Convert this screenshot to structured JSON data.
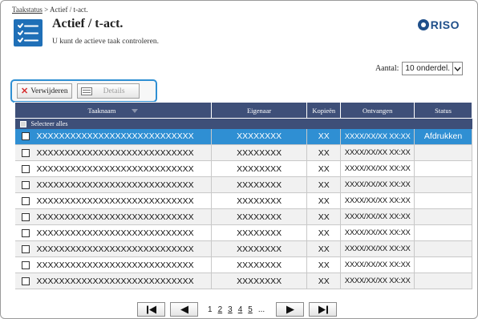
{
  "breadcrumb": {
    "link": "Taakstatus",
    "separator": " > ",
    "current": "Actief / t-act."
  },
  "header": {
    "title": "Actief / t-act.",
    "subtitle": "U kunt de actieve taak controleren.",
    "logo_text": "RISO",
    "icon": "task-list-icon"
  },
  "count": {
    "label": "Aantal:",
    "value": "10 onderdel."
  },
  "toolbar": {
    "delete_label": "Verwijderen",
    "details_label": "Details"
  },
  "table": {
    "columns": [
      "Taaknaam",
      "Eigenaar",
      "Kopieën",
      "Ontvangen",
      "Status"
    ],
    "select_all_label": "Selecteer alles",
    "rows": [
      {
        "name": "XXXXXXXXXXXXXXXXXXXXXXXXXXXX",
        "owner": "XXXXXXXX",
        "copies": "XX",
        "received": "XXXX/XX/XX XX:XX",
        "status": "Afdrukken"
      },
      {
        "name": "XXXXXXXXXXXXXXXXXXXXXXXXXXXX",
        "owner": "XXXXXXXX",
        "copies": "XX",
        "received": "XXXX/XX/XX XX:XX",
        "status": ""
      },
      {
        "name": "XXXXXXXXXXXXXXXXXXXXXXXXXXXX",
        "owner": "XXXXXXXX",
        "copies": "XX",
        "received": "XXXX/XX/XX XX:XX",
        "status": ""
      },
      {
        "name": "XXXXXXXXXXXXXXXXXXXXXXXXXXXX",
        "owner": "XXXXXXXX",
        "copies": "XX",
        "received": "XXXX/XX/XX XX:XX",
        "status": ""
      },
      {
        "name": "XXXXXXXXXXXXXXXXXXXXXXXXXXXX",
        "owner": "XXXXXXXX",
        "copies": "XX",
        "received": "XXXX/XX/XX XX:XX",
        "status": ""
      },
      {
        "name": "XXXXXXXXXXXXXXXXXXXXXXXXXXXX",
        "owner": "XXXXXXXX",
        "copies": "XX",
        "received": "XXXX/XX/XX XX:XX",
        "status": ""
      },
      {
        "name": "XXXXXXXXXXXXXXXXXXXXXXXXXXXX",
        "owner": "XXXXXXXX",
        "copies": "XX",
        "received": "XXXX/XX/XX XX:XX",
        "status": ""
      },
      {
        "name": "XXXXXXXXXXXXXXXXXXXXXXXXXXXX",
        "owner": "XXXXXXXX",
        "copies": "XX",
        "received": "XXXX/XX/XX XX:XX",
        "status": ""
      },
      {
        "name": "XXXXXXXXXXXXXXXXXXXXXXXXXXXX",
        "owner": "XXXXXXXX",
        "copies": "XX",
        "received": "XXXX/XX/XX XX:XX",
        "status": ""
      },
      {
        "name": "XXXXXXXXXXXXXXXXXXXXXXXXXXXX",
        "owner": "XXXXXXXX",
        "copies": "XX",
        "received": "XXXX/XX/XX XX:XX",
        "status": ""
      }
    ],
    "selected_row": 0
  },
  "pagination": {
    "pages": [
      "1",
      "2",
      "3",
      "4",
      "5"
    ],
    "current": "1",
    "ellipsis": "..."
  },
  "colors": {
    "accent": "#2f8fd3",
    "header_bg": "#3e4f78",
    "brand": "#1f4f8a",
    "delete_icon": "#d62f2f"
  }
}
